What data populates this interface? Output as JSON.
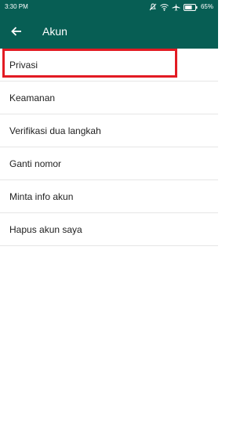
{
  "status_bar": {
    "time": "3:30 PM",
    "battery": "65%",
    "icons": [
      "notification-off-icon",
      "wifi-icon",
      "airplane-mode-icon",
      "battery-icon"
    ]
  },
  "app_bar": {
    "title": "Akun",
    "back_icon": "back-arrow-icon"
  },
  "menu": {
    "items": [
      {
        "label": "Privasi"
      },
      {
        "label": "Keamanan"
      },
      {
        "label": "Verifikasi dua langkah"
      },
      {
        "label": "Ganti nomor"
      },
      {
        "label": "Minta info akun"
      },
      {
        "label": "Hapus akun saya"
      }
    ]
  },
  "colors": {
    "primary": "#075e54",
    "highlight": "#e21b23",
    "divider": "#e6e6e6"
  }
}
